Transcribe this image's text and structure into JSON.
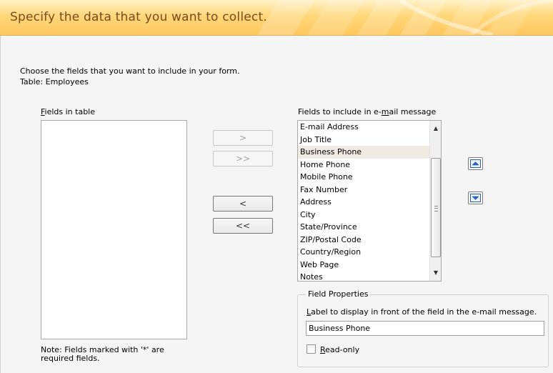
{
  "header": {
    "title": "Specify the data that you want to collect."
  },
  "instructions": {
    "line1": "Choose the fields that you want to include in your form.",
    "line2": "Table: Employees"
  },
  "fields_in_table": {
    "label_prefix": "",
    "label_accesskey": "F",
    "label_rest": "ields in table",
    "items": []
  },
  "buttons": {
    "add": ">",
    "add_all": ">>",
    "remove": "<",
    "remove_all": "<<"
  },
  "fields_to_include": {
    "label_prefix": "Fields to include in e-",
    "label_accesskey": "m",
    "label_rest": "ail message",
    "items": [
      "E-mail Address",
      "Job Title",
      "Business Phone",
      "Home Phone",
      "Mobile Phone",
      "Fax Number",
      "Address",
      "City",
      "State/Province",
      "ZIP/Postal Code",
      "Country/Region",
      "Web Page",
      "Notes"
    ],
    "selected_item": "Business Phone"
  },
  "move_buttons": {
    "up_icon": "move-up-icon",
    "down_icon": "move-down-icon"
  },
  "field_properties": {
    "title": "Field Properties",
    "label_prefix": "",
    "label_accesskey": "L",
    "label_rest": "abel to display in front of the field in the e-mail message.",
    "label_value": "Business Phone",
    "readonly_prefix": "",
    "readonly_accesskey": "R",
    "readonly_rest": "ead-only"
  },
  "note": {
    "text": "Note: Fields marked with '*' are required fields."
  },
  "colors": {
    "header_text": "#7b4a1f",
    "header_bg": "#ffd77a",
    "selection_bg": "#efebe2",
    "disabled_text": "#a2a2a2"
  }
}
